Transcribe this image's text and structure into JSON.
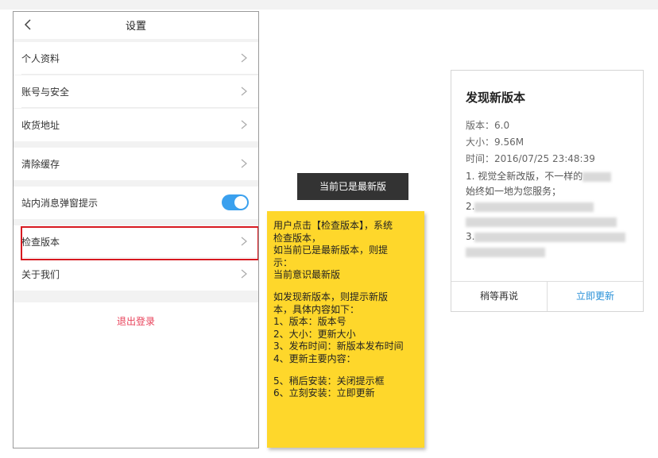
{
  "settings": {
    "title": "设置",
    "items": [
      {
        "label": "个人资料"
      },
      {
        "label": "账号与安全"
      },
      {
        "label": "收货地址"
      },
      {
        "label": "清除缓存"
      },
      {
        "label": "站内消息弹窗提示"
      },
      {
        "label": "检查版本"
      },
      {
        "label": "关于我们"
      }
    ],
    "notification_toggle_on": true,
    "logout_label": "退出登录"
  },
  "toast": {
    "text": "当前已是最新版"
  },
  "note": {
    "lines_a": [
      "用户点击【检查版本】，系统",
      "检查版本，",
      "如当前已是最新版本，则提",
      "示：",
      "当前意识最新版"
    ],
    "lines_b": [
      "如发现新版本，则提示新版",
      "本，具体内容如下：",
      "1、版本：版本号",
      "2、大小：更新大小",
      "3、发布时间：新版本发布时间",
      "4、更新主要内容："
    ],
    "lines_c": [
      "5、稍后安装：关闭提示框",
      "6、立刻安装：立即更新"
    ]
  },
  "dialog": {
    "title": "发现新版本",
    "version": "版本：6.0",
    "size": "大小：9.56M",
    "time": "时间：2016/07/25 23:48:39",
    "note1": "1. 视觉全新改版，不一样的",
    "note1b": "始终如一地为您服务；",
    "note2": "2.",
    "note3": "3.",
    "later_label": "稍等再说",
    "update_label": "立即更新"
  },
  "colors": {
    "accent": "#3aa0ee",
    "highlight": "#d71920",
    "logout": "#e8425a",
    "note": "#fed72b",
    "toast": "#333333",
    "update": "#2a91d8"
  }
}
